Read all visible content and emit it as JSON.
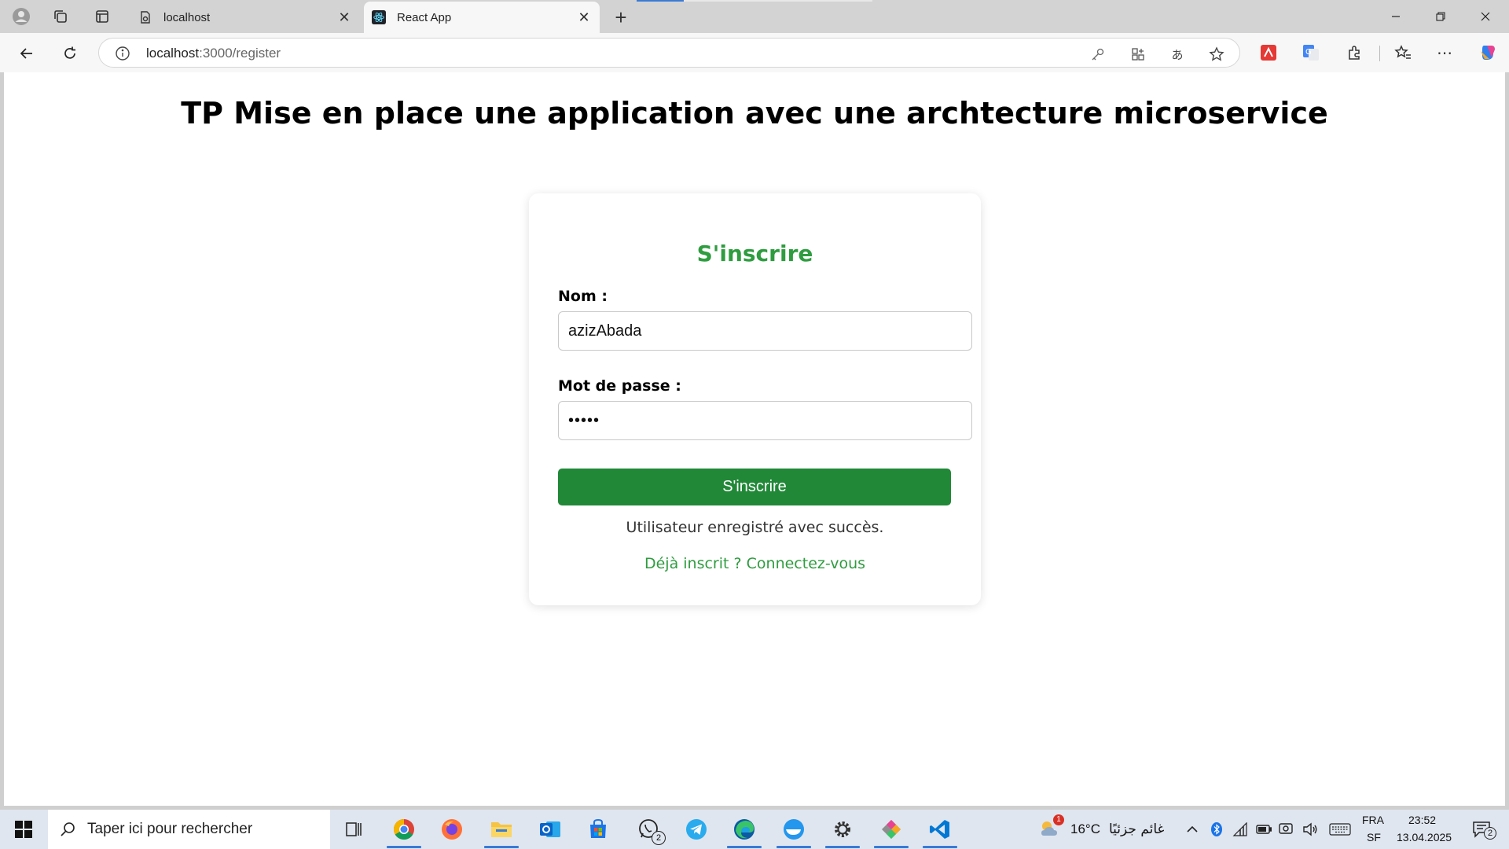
{
  "browser": {
    "tabs": [
      {
        "title": "localhost",
        "active": false
      },
      {
        "title": "React App",
        "active": true
      }
    ],
    "url_host": "localhost",
    "url_path": ":3000/register"
  },
  "page": {
    "title": "TP Mise en place une application avec une archtecture microservice"
  },
  "form": {
    "heading": "S'inscrire",
    "name_label": "Nom :",
    "name_value": "azizAbada",
    "password_label": "Mot de passe :",
    "password_value": "•••••",
    "submit_label": "S'inscrire",
    "message": "Utilisateur enregistré avec succès.",
    "login_link": "Déjà inscrit ? Connectez-vous"
  },
  "taskbar": {
    "search_placeholder": "Taper ici pour rechercher",
    "weather_temp": "16°C",
    "weather_desc": "غائم جزئيًا",
    "weather_badge": "1",
    "whatsapp_badge": "2",
    "lang_top": "FRA",
    "lang_bottom": "SF",
    "time": "23:52",
    "date": "13.04.2025",
    "notifications": "2"
  },
  "colors": {
    "accent_green": "#2e9c3f",
    "button_green": "#218838",
    "taskbar_bg": "#dfe6ef"
  }
}
